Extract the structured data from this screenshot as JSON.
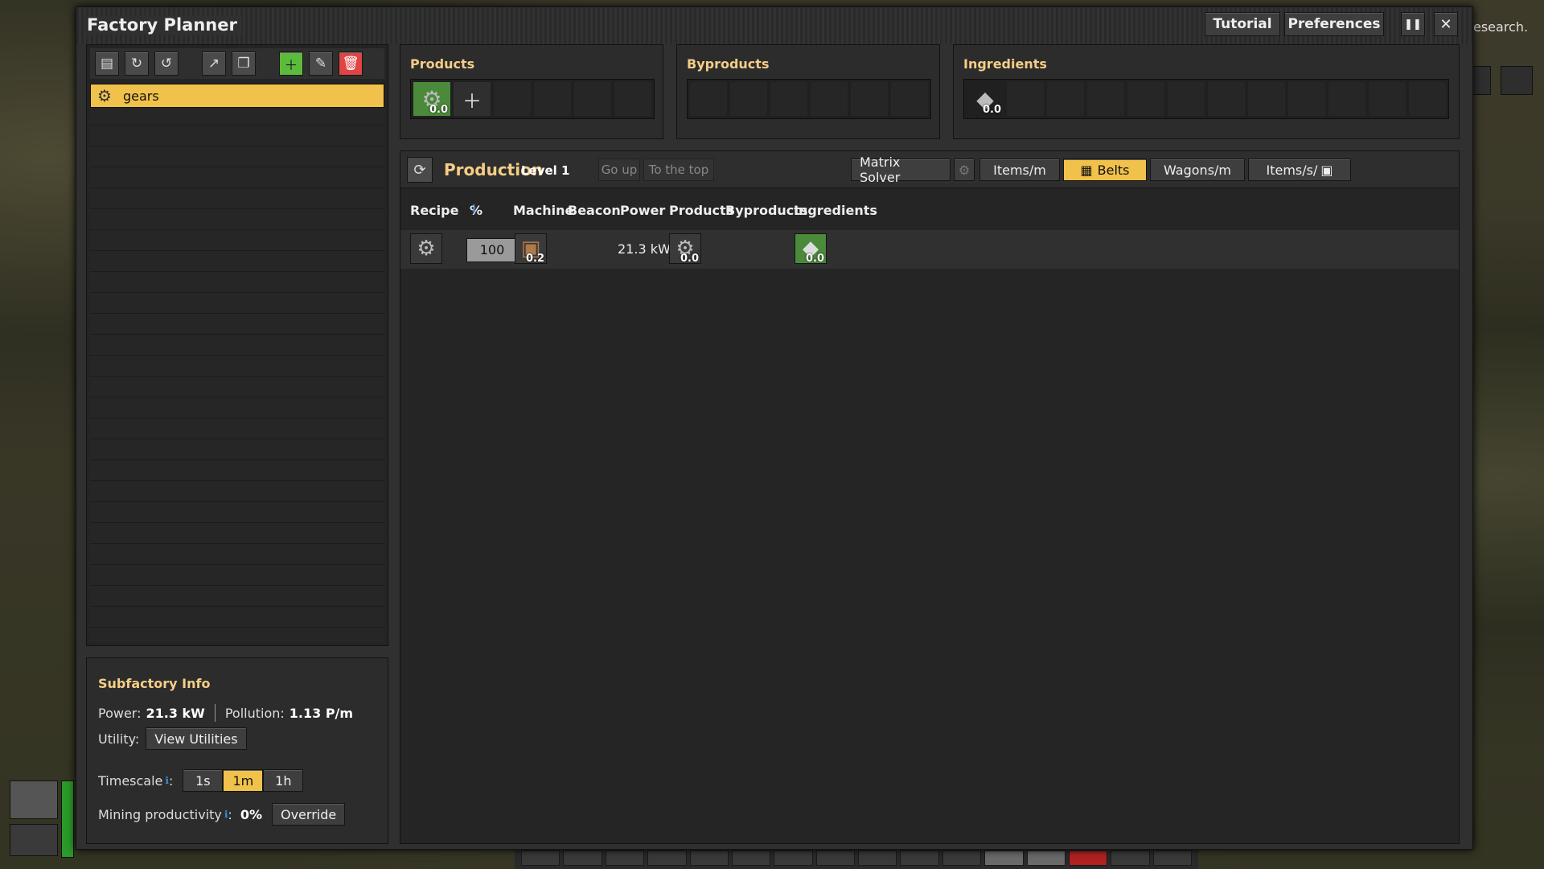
{
  "window": {
    "title": "Factory Planner",
    "tutorial": "Tutorial",
    "preferences": "Preferences",
    "pause_icon": "pause-icon",
    "close_icon": "close-icon"
  },
  "background": {
    "research_text": "esearch."
  },
  "toolbar": {
    "icons": [
      "archive-icon",
      "import-icon",
      "undo-icon",
      "export-icon",
      "duplicate-icon",
      "add-icon",
      "edit-icon",
      "delete-icon"
    ]
  },
  "subfactories": [
    {
      "name": "gears",
      "icon": "gear-icon",
      "selected": true
    }
  ],
  "subfactory_info": {
    "title": "Subfactory Info",
    "power_label": "Power:",
    "power_value": "21.3 kW",
    "pollution_label": "Pollution:",
    "pollution_value": "1.13 P/m",
    "utility_label": "Utility:",
    "view_utilities": "View Utilities",
    "timescale_label": "Timescale",
    "timescales": [
      "1s",
      "1m",
      "1h"
    ],
    "timescale_selected": "1m",
    "mining_label": "Mining productivity",
    "mining_value": "0%",
    "override": "Override"
  },
  "products": {
    "title": "Products",
    "items": [
      {
        "icon": "gear-icon",
        "amount": "0.0"
      }
    ],
    "add_icon": "plus-icon"
  },
  "byproducts": {
    "title": "Byproducts",
    "items": []
  },
  "ingredients": {
    "title": "Ingredients",
    "items": [
      {
        "icon": "iron-plate-icon",
        "amount": "0.0"
      }
    ]
  },
  "production": {
    "title": "Production",
    "level": "Level 1",
    "go_up": "Go up",
    "to_top": "To the top",
    "matrix_solver": "Matrix Solver",
    "units": [
      "Items/m",
      "Belts",
      "Wagons/m",
      "Items/s/"
    ],
    "unit_selected": "Belts",
    "columns": [
      "Recipe",
      "%",
      "Machine",
      "Beacon",
      "Power",
      "Products",
      "Byproducts",
      "Ingredients"
    ],
    "rows": [
      {
        "recipe": "gear-icon",
        "percent": "100",
        "machine_count": "0.2",
        "power": "21.3 kW",
        "product_amount": "0.0",
        "ingredient_amount": "0.0"
      }
    ]
  },
  "colors": {
    "accent": "#f1c24b",
    "heading": "#f5cd86",
    "add": "#5dbb3c",
    "delete": "#e04444"
  }
}
